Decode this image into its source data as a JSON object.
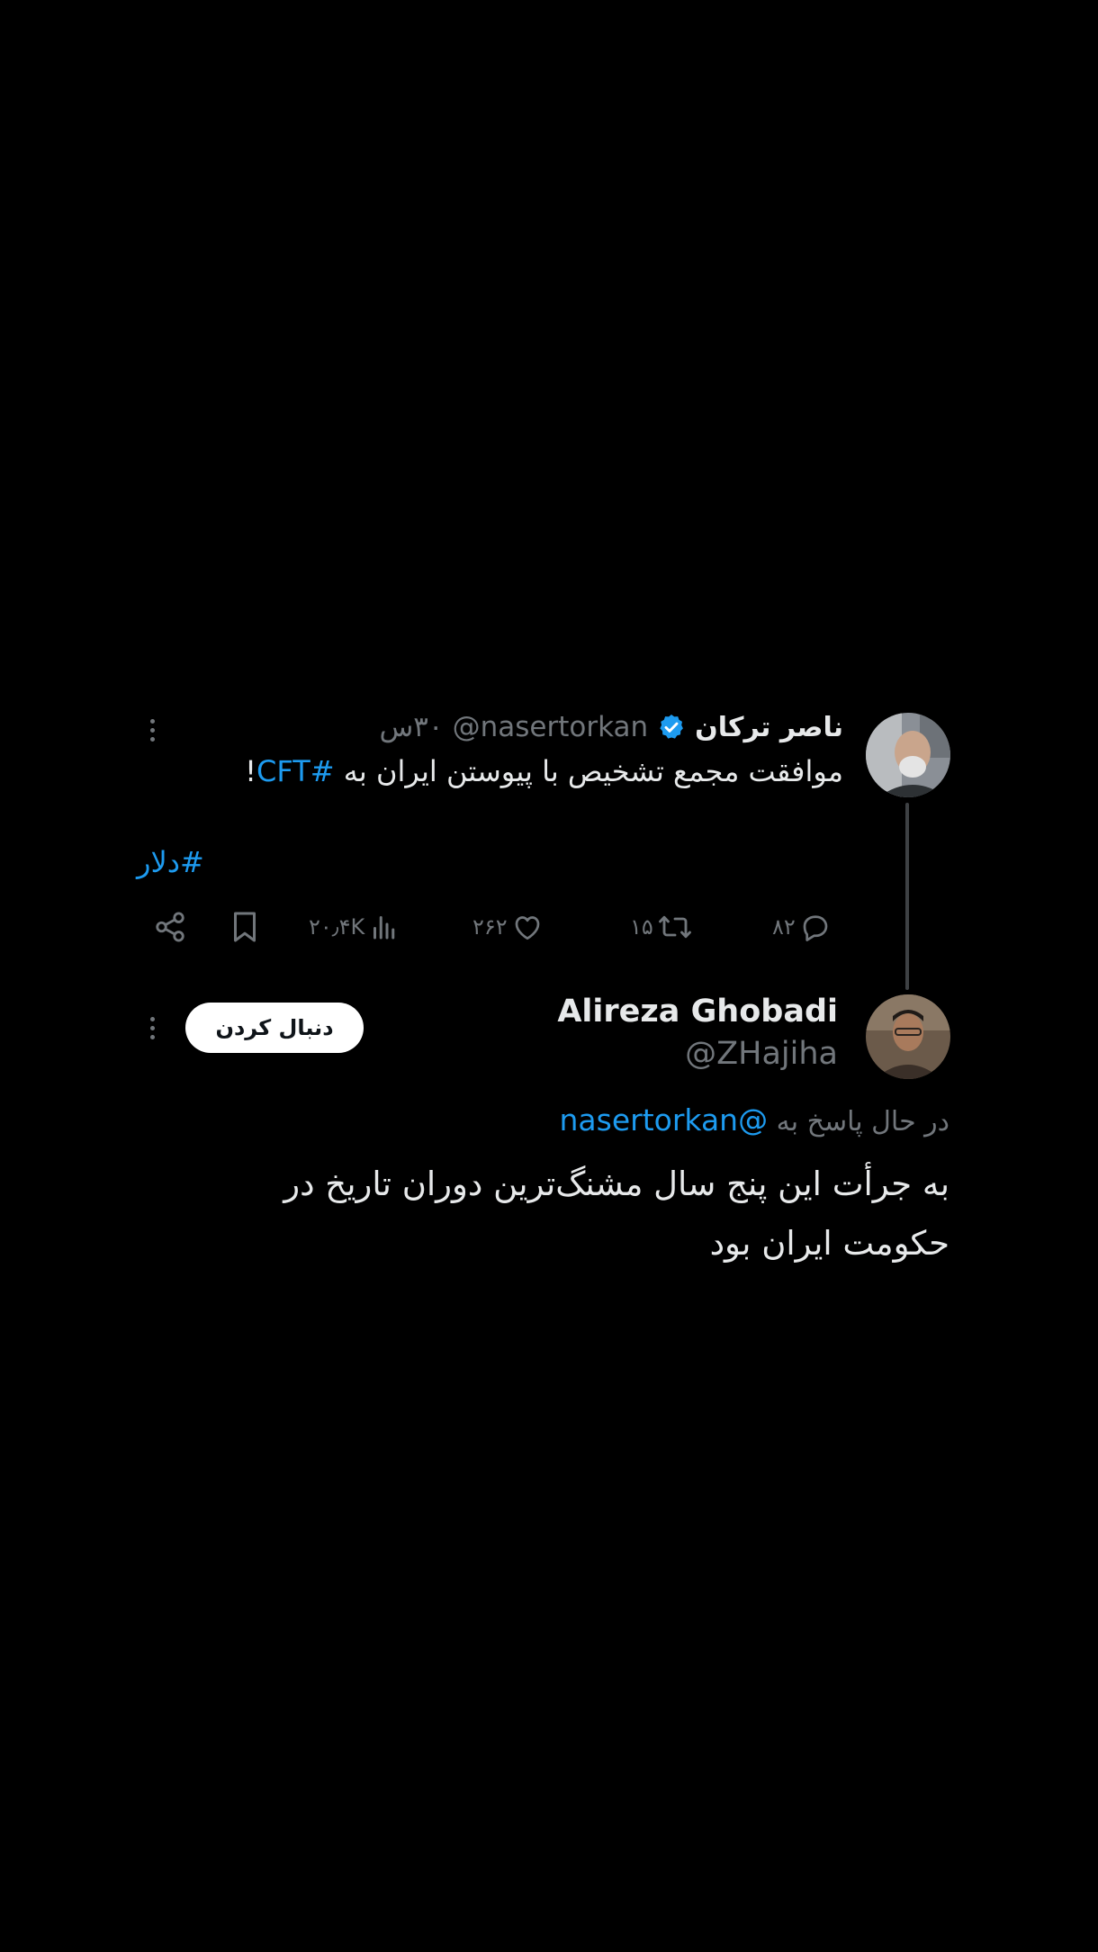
{
  "tweet1": {
    "author_name": "ناصر ترکان",
    "handle": "@nasertorkan",
    "time": "۳۰س",
    "text_before": "موافقت مجمع تشخیص با پیوستن ایران به ",
    "hashtag_inline": "#CFT",
    "text_after": "!",
    "hashtag_line": "#دلار",
    "replies": "۸۲",
    "retweets": "۱۵",
    "likes": "۲۶۲",
    "views": "۲۰٫۴K"
  },
  "tweet2": {
    "author_name": "Alireza Ghobadi",
    "handle": "@ZHajiha",
    "follow_label": "دنبال کردن",
    "reply_prefix": "در حال پاسخ به ",
    "reply_mention": "@nasertorkan",
    "text": "به جرأت این پنج سال مشنگ‌ترین دوران تاریخ در حکومت ایران بود"
  },
  "colors": {
    "background": "#000000",
    "text_primary": "#e7e9ea",
    "text_secondary": "#71767b",
    "link": "#1d9bf0",
    "verified": "#1d9bf0"
  },
  "icons": [
    "verified-badge-icon",
    "more-icon",
    "reply-icon",
    "retweet-icon",
    "like-icon",
    "views-icon",
    "bookmark-icon",
    "share-icon"
  ]
}
